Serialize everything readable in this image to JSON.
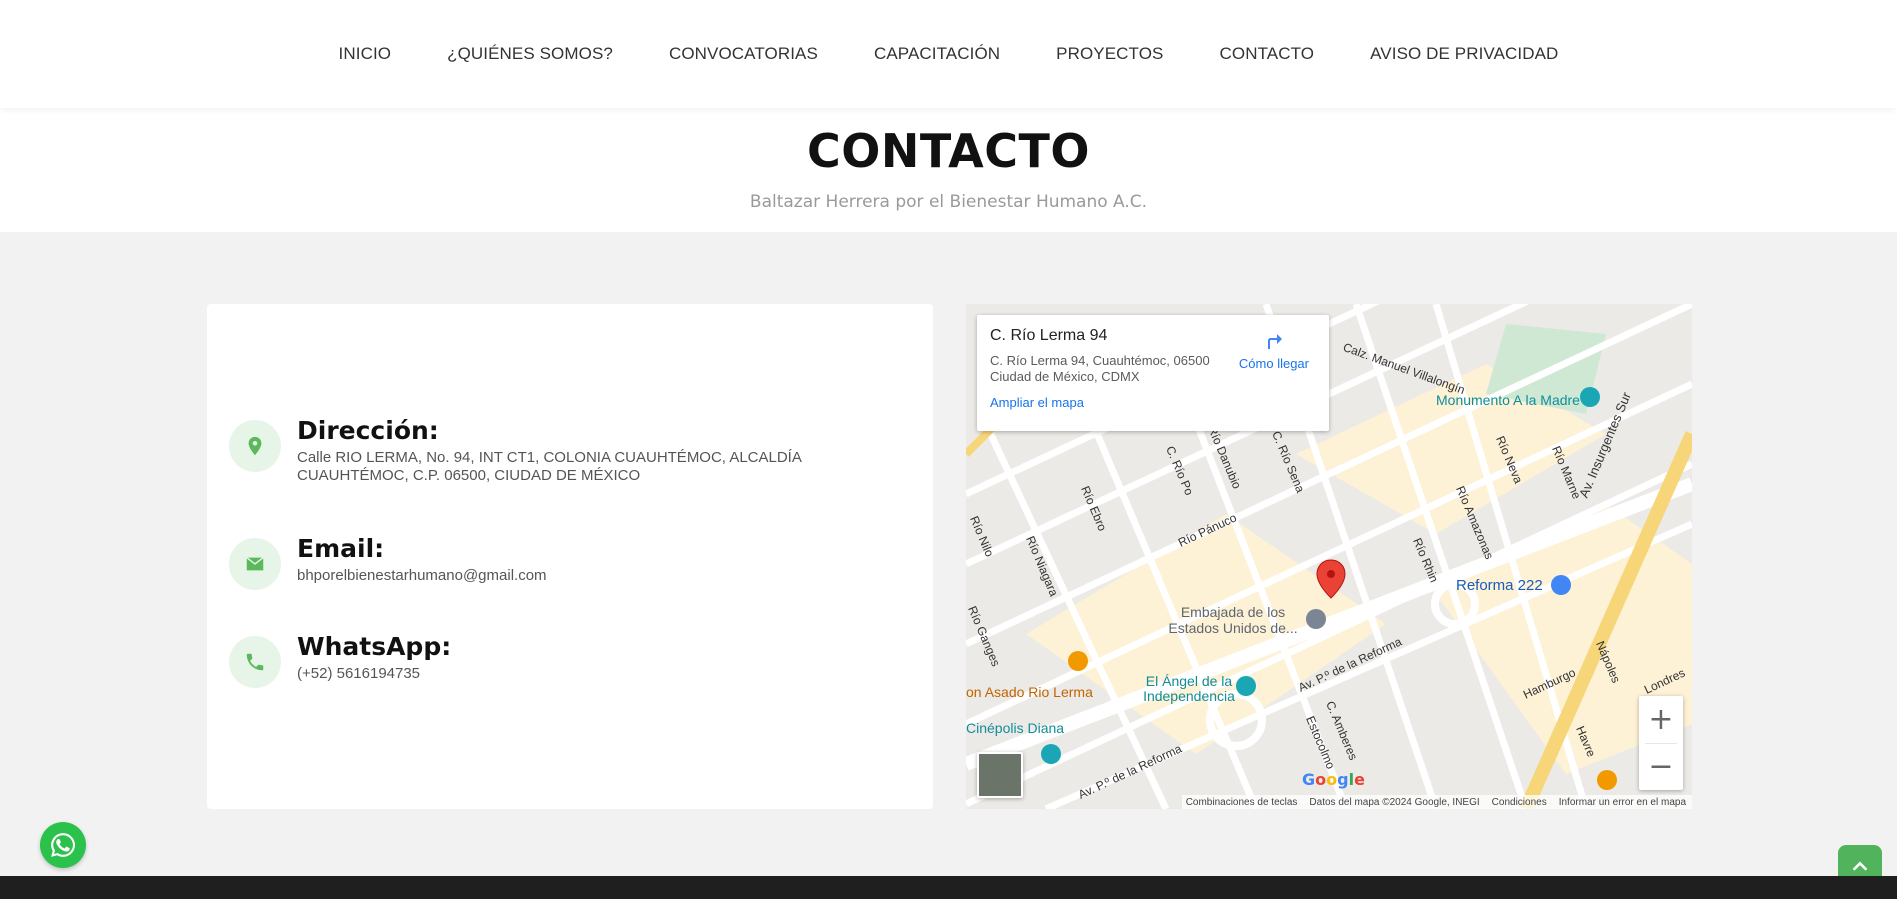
{
  "nav": {
    "items": [
      "INICIO",
      "¿QUIÉNES SOMOS?",
      "CONVOCATORIAS",
      "CAPACITACIÓN",
      "PROYECTOS",
      "CONTACTO",
      "AVISO DE PRIVACIDAD"
    ]
  },
  "hero": {
    "title": "CONTACTO",
    "subtitle": "Baltazar Herrera por el Bienestar Humano A.C."
  },
  "contact": {
    "address": {
      "label": "Dirección:",
      "value": "Calle RIO LERMA, No. 94, INT CT1, COLONIA CUAUHTÉMOC, ALCALDÍA CUAUHTÉMOC, C.P. 06500, CIUDAD DE MÉXICO"
    },
    "email": {
      "label": "Email:",
      "value": "bhporelbienestarhumano@gmail.com"
    },
    "whatsapp": {
      "label": "WhatsApp:",
      "value": "(+52) 5616194735"
    }
  },
  "map": {
    "popup": {
      "title": "C. Río Lerma 94",
      "address": "C. Río Lerma 94, Cuauhtémoc, 06500 Ciudad de México, CDMX",
      "directions": "Cómo llegar",
      "enlarge": "Ampliar el mapa"
    },
    "labels": {
      "monumento": "Monumento A la Madre",
      "reforma222": "Reforma 222",
      "embajada": "Embajada de los Estados Unidos de...",
      "angel": "El Ángel de la Independencia",
      "asado": "on Asado Rio Lerma",
      "cinepolis": "Cinépolis Diana",
      "insurgentes": "Av. Insurgentes Sur",
      "reforma": "Av. P.º de la Reforma",
      "villalongin": "Calz. Manuel Villalongín",
      "rioPanuco": "Río Pánuco",
      "rioRhin": "Río Rhin",
      "rioNeva": "Río Neva",
      "rioMarne": "Río Marne",
      "rioAmazonas": "Río Amazonas",
      "rioEbro": "Río Ebro",
      "rioNilo": "Río Nilo",
      "rioNiagara": "Río Niagara",
      "rioGanges": "Río Ganges",
      "rioPo": "C. Río Po",
      "rioDanubio": "Río Danubio",
      "rioSena": "C. Río Sena",
      "hamburgo": "Hamburgo",
      "napoles": "Nápoles",
      "londres": "Londres",
      "havre": "Havre",
      "amberes": "C. Amberes",
      "estocolmo": "Estocolmo"
    },
    "zoom_in": "+",
    "zoom_out": "−",
    "google": "Google",
    "attribution": {
      "shortcuts": "Combinaciones de teclas",
      "data": "Datos del mapa ©2024 Google, INEGI",
      "terms": "Condiciones",
      "report": "Informar un error en el mapa"
    }
  }
}
